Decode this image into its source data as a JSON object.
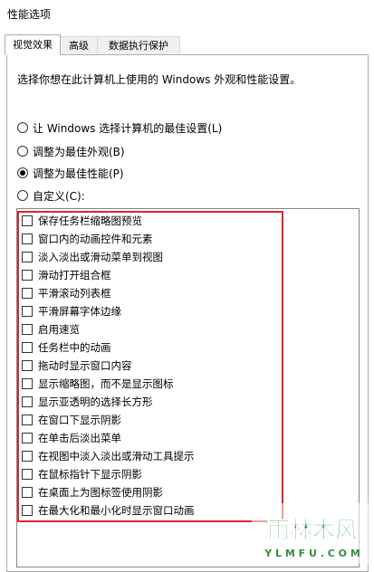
{
  "window": {
    "title": "性能选项"
  },
  "tabs": [
    {
      "label": "视觉效果",
      "active": true
    },
    {
      "label": "高级",
      "active": false
    },
    {
      "label": "数据执行保护",
      "active": false
    }
  ],
  "description": "选择你想在此计算机上使用的 Windows 外观和性能设置。",
  "radios": [
    {
      "label": "让 Windows 选择计算机的最佳设置(L)",
      "checked": false
    },
    {
      "label": "调整为最佳外观(B)",
      "checked": false
    },
    {
      "label": "调整为最佳性能(P)",
      "checked": true
    },
    {
      "label": "自定义(C):",
      "checked": false
    }
  ],
  "options": [
    "保存任务栏缩略图预览",
    "窗口内的动画控件和元素",
    "淡入淡出或滑动菜单到视图",
    "滑动打开组合框",
    "平滑滚动列表框",
    "平滑屏幕字体边缘",
    "启用速览",
    "任务栏中的动画",
    "拖动时显示窗口内容",
    "显示缩略图，而不是显示图标",
    "显示亚透明的选择长方形",
    "在窗口下显示阴影",
    "在单击后淡出菜单",
    "在视图中淡入淡出或滑动工具提示",
    "在鼠标指针下显示阴影",
    "在桌面上为图标签使用阴影",
    "在最大化和最小化时显示窗口动画"
  ],
  "watermark": {
    "logo": "雨林木风",
    "url": "Y L M F U . C O M"
  },
  "colors": {
    "highlight": "#d9262a",
    "watermark_green": "#2f8f3f"
  }
}
